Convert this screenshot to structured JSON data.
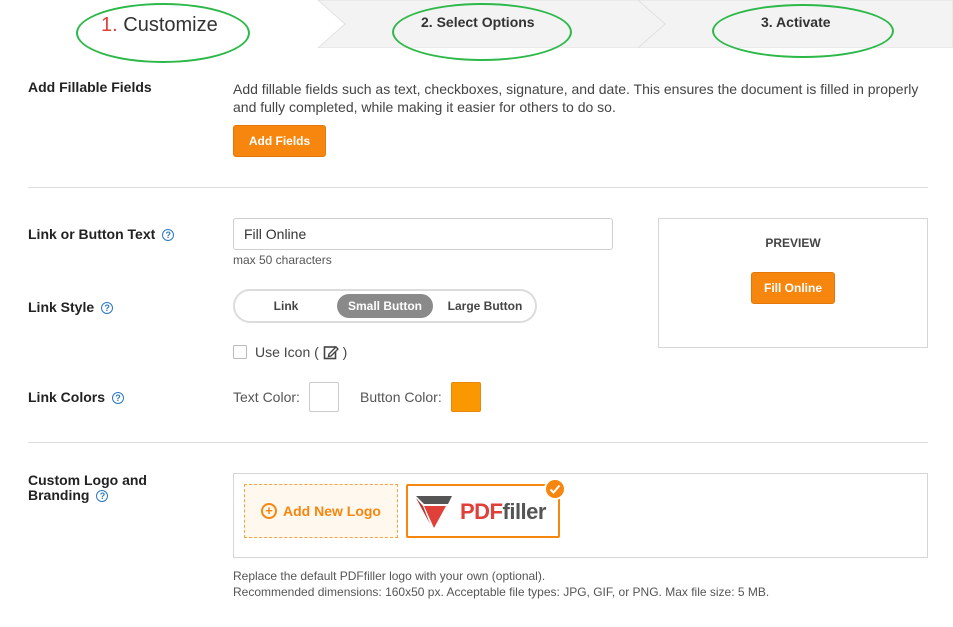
{
  "steps": [
    {
      "number": "1.",
      "label": "Customize"
    },
    {
      "label": "2. Select Options"
    },
    {
      "label": "3. Activate"
    }
  ],
  "fillable": {
    "label": "Add Fillable Fields",
    "description": "Add fillable fields such as text, checkboxes, signature, and date. This ensures the document is filled in properly and fully completed, while making it easier for others to do so.",
    "button": "Add Fields"
  },
  "link_text": {
    "label": "Link or Button Text",
    "value": "Fill Online",
    "hint": "max 50 characters"
  },
  "link_style": {
    "label": "Link Style",
    "options": [
      "Link",
      "Small Button",
      "Large Button"
    ],
    "selected": "Small Button",
    "use_icon_label": "Use Icon (",
    "use_icon_suffix": ")",
    "use_icon_checked": false
  },
  "link_colors": {
    "label": "Link Colors",
    "text_color_label": "Text Color:",
    "text_color": "#ffffff",
    "button_color_label": "Button Color:",
    "button_color": "#fb9700"
  },
  "preview": {
    "title": "PREVIEW",
    "button": "Fill Online"
  },
  "branding": {
    "label_line1": "Custom Logo and",
    "label_line2": "Branding",
    "add_logo": "Add New Logo",
    "logo_pdf": "PDF",
    "logo_filler": "filler",
    "note_line1": "Replace the default PDFfiller logo with your own (optional).",
    "note_line2": "Recommended dimensions: 160x50 px. Acceptable file types: JPG, GIF, or PNG. Max file size: 5 MB."
  },
  "help_icon": "?",
  "colors": {
    "accent": "#f7860f",
    "step_number": "#e0403a",
    "annotation": "#2db84a",
    "help": "#2b78c5"
  }
}
